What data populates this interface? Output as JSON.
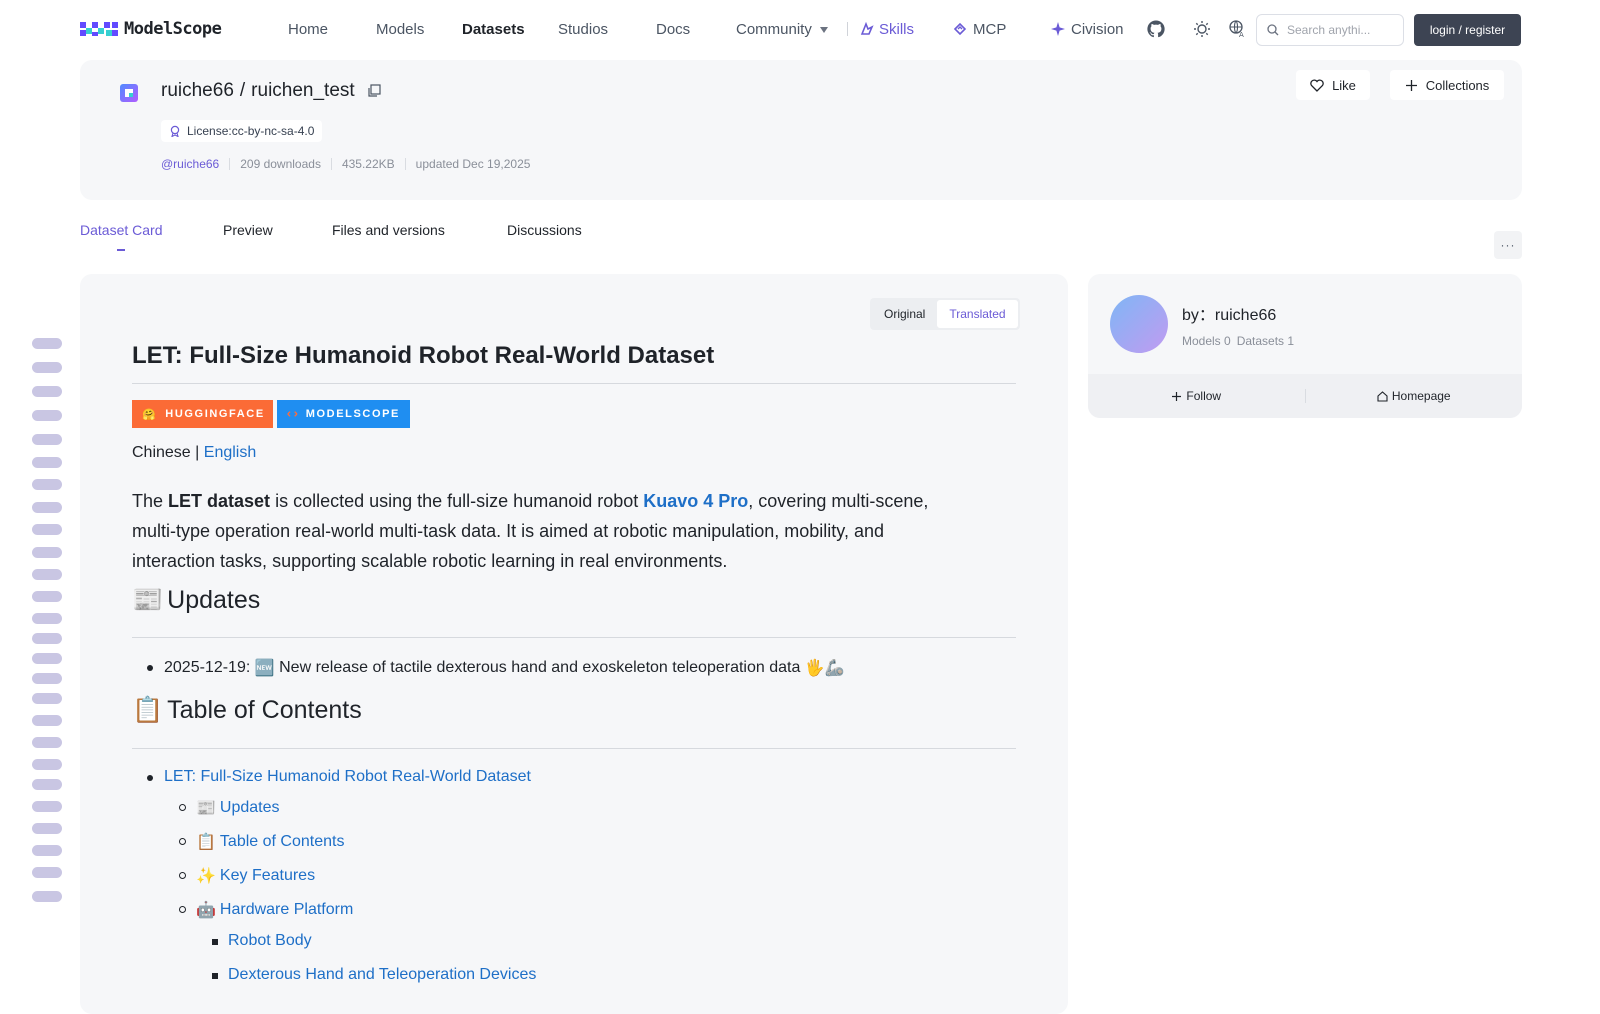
{
  "nav": {
    "logo_text": "ModelScope",
    "links": [
      "Home",
      "Models",
      "Datasets",
      "Studios",
      "Docs",
      "Community"
    ],
    "active": "Datasets",
    "skills": "Skills",
    "mcp": "MCP",
    "civision": "Civision",
    "search_placeholder": "Search anythi...",
    "login": "login / register"
  },
  "dataset": {
    "owner": "ruiche66",
    "separator": "/",
    "name": "ruichen_test",
    "license": "License:cc-by-nc-sa-4.0",
    "user": "@ruiche66",
    "downloads": "209 downloads",
    "size": "435.22KB",
    "updated": "updated Dec 19,2025",
    "like": "Like",
    "collections": "Collections"
  },
  "tabs": [
    "Dataset Card",
    "Preview",
    "Files and versions",
    "Discussions"
  ],
  "more": "···",
  "card": {
    "toggle": [
      "Original",
      "Translated"
    ],
    "title": "LET: Full-Size Humanoid Robot Real-World Dataset",
    "badge_hf": "HUGGINGFACE",
    "badge_ms": "MODELSCOPE",
    "lang_chinese": "Chinese",
    "lang_sep": "|",
    "lang_english": "English",
    "intro_1": "The ",
    "intro_bold": "LET dataset",
    "intro_2": " is collected using the full-size humanoid robot ",
    "intro_link": "Kuavo 4 Pro",
    "intro_3": ", covering multi-scene, multi-type operation real-world multi-task data. It is aimed at robotic manipulation, mobility, and interaction tasks, supporting scalable robotic learning in real environments.",
    "updates_heading": "Updates",
    "updates_emoji": "📰",
    "update_item_date": "2025-12-19:",
    "update_item_new": "🆕",
    "update_item_text": "New release of tactile dexterous hand and exoskeleton teleoperation data",
    "update_item_emoji": "🖐🦾",
    "toc_heading": "Table of Contents",
    "toc_emoji": "📋",
    "toc": {
      "top": "LET: Full-Size Humanoid Robot Real-World Dataset",
      "items": [
        {
          "emoji": "📰",
          "label": "Updates"
        },
        {
          "emoji": "📋",
          "label": "Table of Contents"
        },
        {
          "emoji": "✨",
          "label": "Key Features"
        },
        {
          "emoji": "🤖",
          "label": "Hardware Platform"
        }
      ],
      "sub": [
        "Robot Body",
        "Dexterous Hand and Teleoperation Devices"
      ]
    }
  },
  "author": {
    "by": "by：ruiche66",
    "models": "Models 0",
    "datasets": "Datasets 1",
    "follow": "Follow",
    "homepage": "Homepage"
  },
  "colors": {
    "accent": "#6b5bd6",
    "link": "#1e6fc7",
    "huggingface": "#fb6b36",
    "modelscope": "#1f8ef1"
  }
}
